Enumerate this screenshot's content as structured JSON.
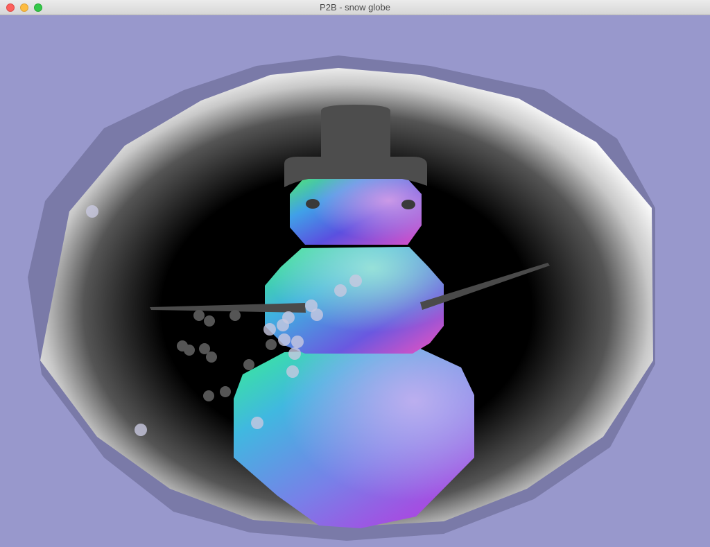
{
  "window": {
    "title": "P2B - snow globe"
  },
  "colors": {
    "background": "#9898cc",
    "globe_rim": "#7a7aa8",
    "hat": "#4d4d4d",
    "arms": "#4a4a4a",
    "snow_dark": "#555555",
    "snow_light": "#c8c8d8"
  },
  "scene": {
    "objects": [
      "snow-globe",
      "snowman",
      "top-hat",
      "left-arm",
      "right-arm",
      "snowflakes"
    ]
  }
}
